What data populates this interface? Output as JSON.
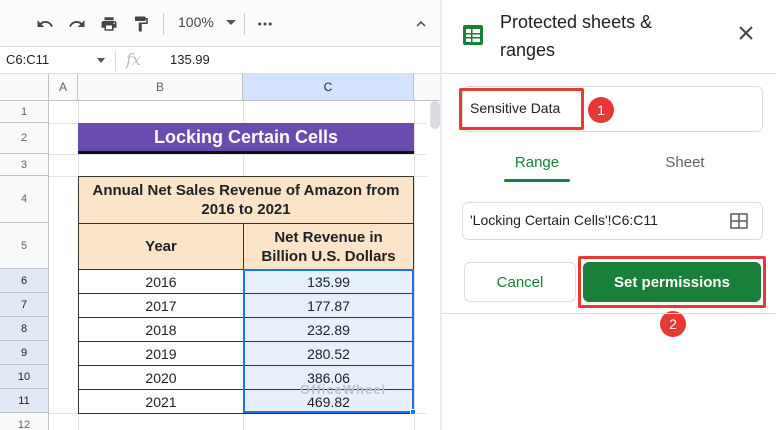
{
  "toolbar": {
    "zoom": "100%",
    "icons": [
      "undo-icon",
      "redo-icon",
      "print-icon",
      "paint-format-icon",
      "more-icon",
      "collapse-icon"
    ]
  },
  "formula_bar": {
    "name_box": "C6:C11",
    "fx": "fx",
    "value": "135.99"
  },
  "grid": {
    "columns": [
      "A",
      "B",
      "C"
    ],
    "rows": [
      "1",
      "2",
      "3",
      "4",
      "5",
      "6",
      "7",
      "8",
      "9",
      "10",
      "11",
      "12"
    ],
    "title": "Locking Certain Cells",
    "table_caption": "Annual Net Sales Revenue of Amazon from 2016 to 2021",
    "header_year": "Year",
    "header_revenue": "Net Revenue in Billion U.S. Dollars",
    "data": [
      {
        "year": "2016",
        "revenue": "135.99"
      },
      {
        "year": "2017",
        "revenue": "177.87"
      },
      {
        "year": "2018",
        "revenue": "232.89"
      },
      {
        "year": "2019",
        "revenue": "280.52"
      },
      {
        "year": "2020",
        "revenue": "386.06"
      },
      {
        "year": "2021",
        "revenue": "469.82"
      }
    ]
  },
  "watermark": "OfficeWheel",
  "panel": {
    "title": "Protected sheets & ranges",
    "description_value": "Sensitive Data",
    "tabs": {
      "range": "Range",
      "sheet": "Sheet"
    },
    "range_value": "'Locking Certain Cells'!C6:C11",
    "cancel_label": "Cancel",
    "set_permissions_label": "Set permissions",
    "badges": [
      "1",
      "2"
    ]
  },
  "colors": {
    "accent_green": "#188038",
    "title_purple": "#6a4baf",
    "header_peach": "#fce4c8",
    "highlight_red": "#e53935",
    "selection_blue": "#1a73e8"
  }
}
